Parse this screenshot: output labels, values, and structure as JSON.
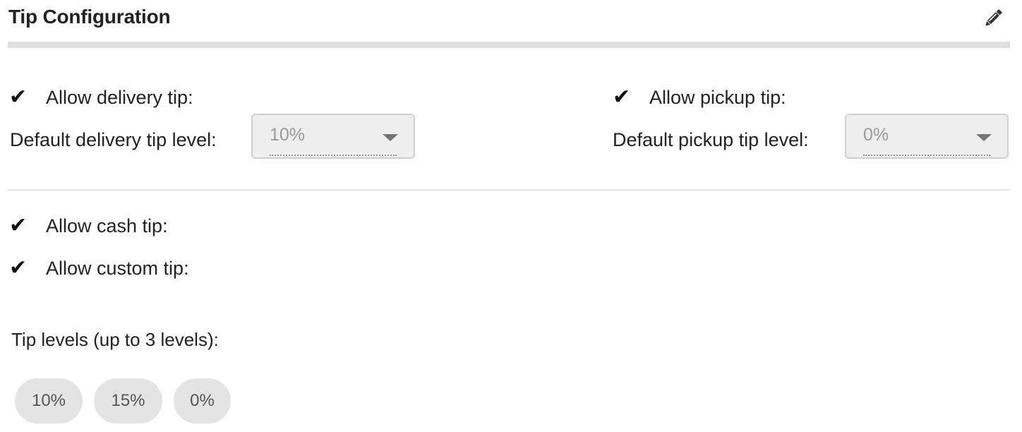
{
  "header": {
    "title": "Tip Configuration",
    "edit_icon": "pencil-icon"
  },
  "delivery": {
    "allow_label": "Allow delivery tip:",
    "allow_checked": true,
    "default_label": "Default delivery tip level:",
    "default_value": "10%"
  },
  "pickup": {
    "allow_label": "Allow pickup tip:",
    "allow_checked": true,
    "default_label": "Default pickup tip level:",
    "default_value": "0%"
  },
  "cash": {
    "allow_label": "Allow cash tip:",
    "allow_checked": true
  },
  "custom": {
    "allow_label": "Allow custom tip:",
    "allow_checked": true
  },
  "check_glyph": "✔",
  "tip_levels": {
    "label": "Tip levels (up to 3 levels):",
    "levels": [
      "10%",
      "15%",
      "0%"
    ]
  },
  "colors": {
    "header_rule": "#e0e0e0",
    "chip_bg": "#e4e4e4",
    "select_bg": "#eeeeee"
  }
}
